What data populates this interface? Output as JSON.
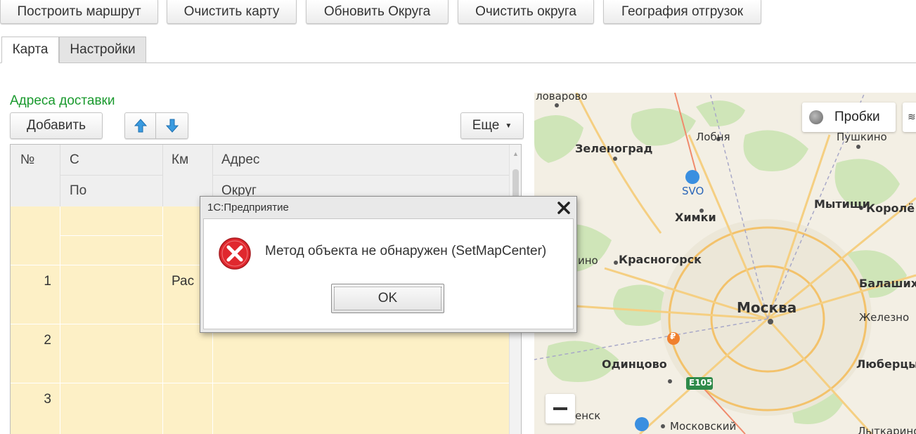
{
  "toolbar": {
    "build_route": "Построить маршрут",
    "clear_map": "Очистить карту",
    "update_districts": "Обновить Округа",
    "clear_districts": "Очистить округа",
    "shipment_geography": "География отгрузок"
  },
  "tabs": [
    {
      "label": "Карта",
      "active": true
    },
    {
      "label": "Настройки",
      "active": false
    }
  ],
  "section": {
    "title": "Адреса доставки",
    "add_label": "Добавить",
    "more_label": "Еще",
    "up_icon": "arrow-up-icon",
    "down_icon": "arrow-down-icon"
  },
  "table": {
    "headers": {
      "num": "№",
      "from": "С",
      "to": "По",
      "km": "Км",
      "address": "Адрес",
      "district": "Округ"
    },
    "rows": [
      {
        "num": "",
        "km": ""
      },
      {
        "num": "1",
        "km": "Рас"
      },
      {
        "num": "2",
        "km": ""
      },
      {
        "num": "3",
        "km": ""
      }
    ]
  },
  "map": {
    "traffic_label": "Пробки",
    "places": {
      "lovarovo": "ловарово",
      "zelenograd": "Зеленоград",
      "lobnya": "Лобня",
      "pushkino": "Пушкино",
      "svo": "SVO",
      "khimki": "Химки",
      "mytishchi": "Мытищи",
      "korolev": "Королё",
      "inoe": "ино",
      "krasnogorsk": "Красногорск",
      "balashikha": "Балаших",
      "moskva": "Москва",
      "zheleznodor": "Железно",
      "odintsovo": "Одинцово",
      "lyubertsy": "Люберцы",
      "e105": "E105",
      "rouble_sign": "₽",
      "yensk": "енск",
      "moskovsky": "Московский",
      "lytkarino": "Лыткарино"
    }
  },
  "dialog": {
    "title": "1С:Предприятие",
    "message": "Метод объекта не обнаружен (SetMapCenter)",
    "ok_label": "OK",
    "colors": {
      "error": "#e0282e"
    }
  }
}
